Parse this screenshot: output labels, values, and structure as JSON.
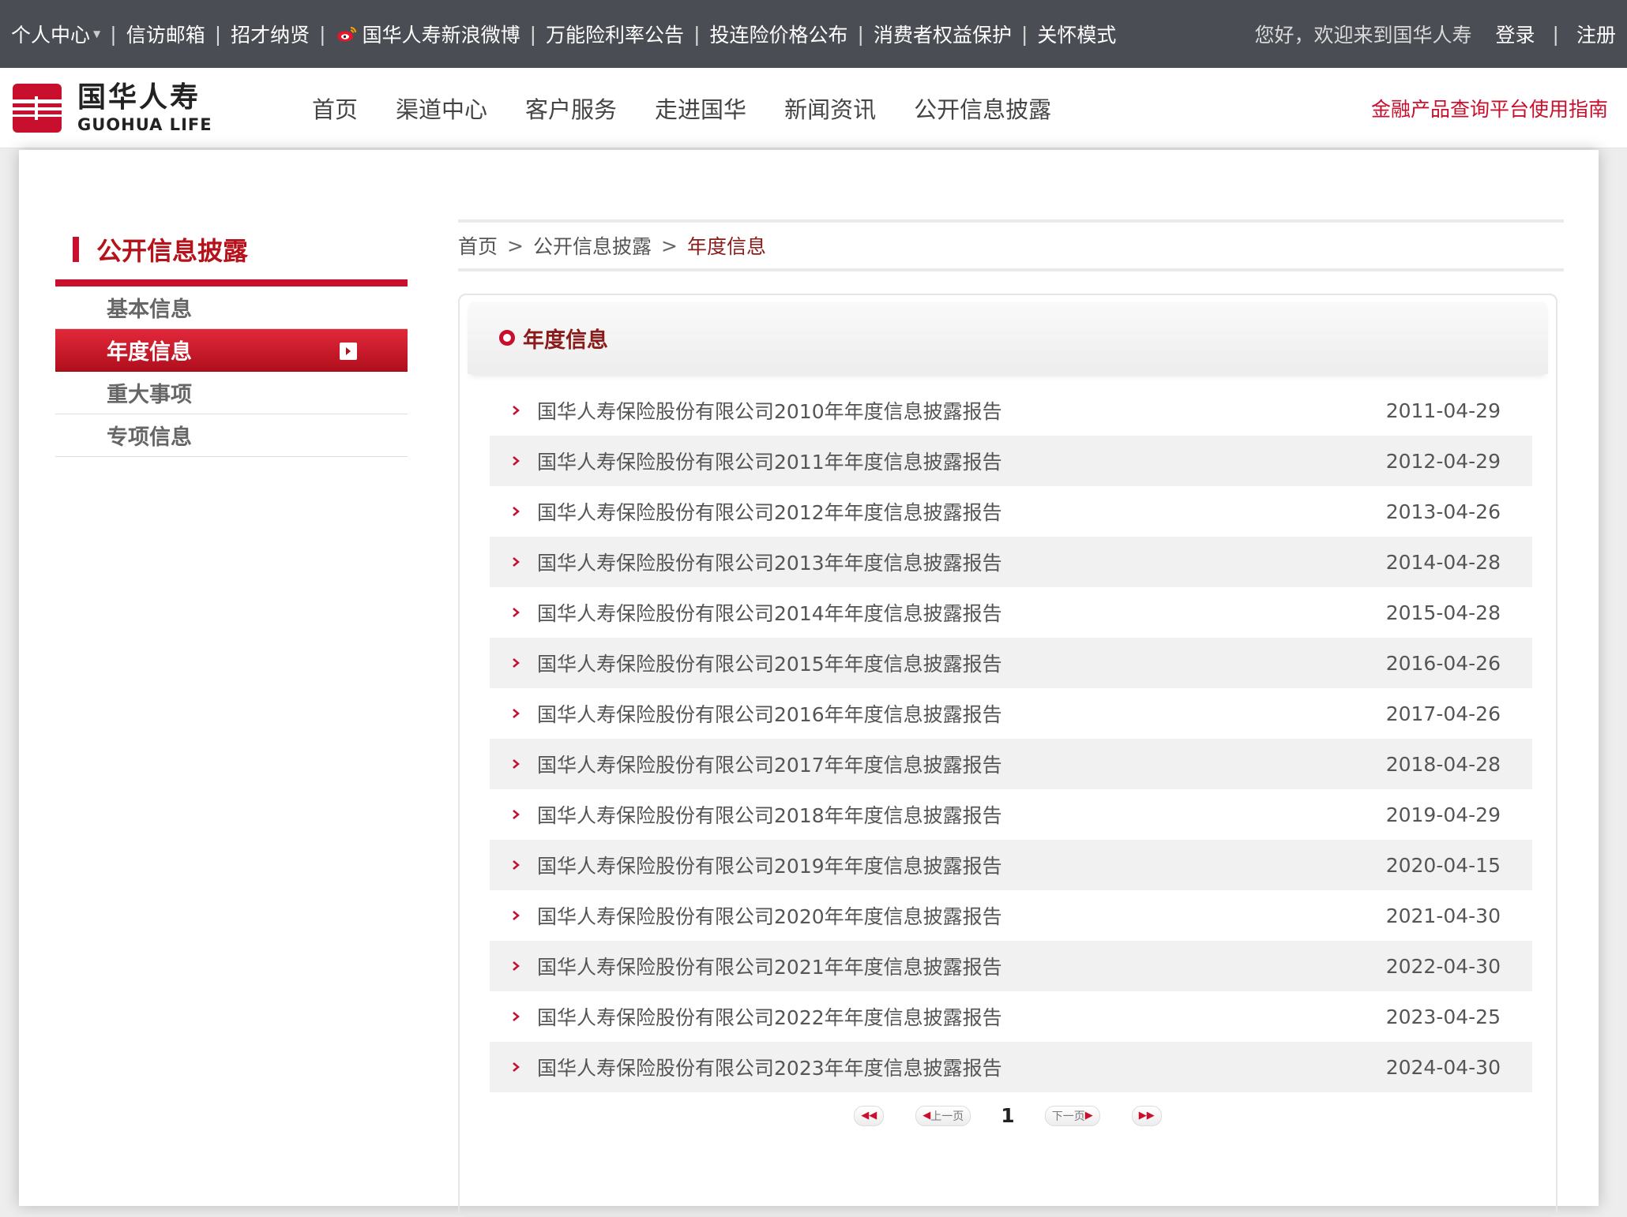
{
  "topbar": {
    "links": [
      "个人中心",
      "信访邮箱",
      "招才纳贤",
      "国华人寿新浪微博",
      "万能险利率公告",
      "投连险价格公布",
      "消费者权益保护",
      "关怀模式"
    ],
    "welcome": "您好，欢迎来到国华人寿",
    "login": "登录",
    "register": "注册",
    "separator": "|"
  },
  "header": {
    "logo_cn": "国华人寿",
    "logo_en": "GUOHUA LIFE",
    "nav": [
      "首页",
      "渠道中心",
      "客户服务",
      "走进国华",
      "新闻资讯",
      "公开信息披露"
    ],
    "guide": "金融产品查询平台使用指南"
  },
  "sidebar": {
    "title": "公开信息披露",
    "items": [
      "基本信息",
      "年度信息",
      "重大事项",
      "专项信息"
    ],
    "active_index": 1
  },
  "breadcrumb": {
    "home": "首页",
    "section": "公开信息披露",
    "current": "年度信息",
    "gt": ">"
  },
  "list": {
    "title": "年度信息",
    "rows": [
      {
        "name": "国华人寿保险股份有限公司2010年年度信息披露报告",
        "date": "2011-04-29"
      },
      {
        "name": "国华人寿保险股份有限公司2011年年度信息披露报告",
        "date": "2012-04-29"
      },
      {
        "name": "国华人寿保险股份有限公司2012年年度信息披露报告",
        "date": "2013-04-26"
      },
      {
        "name": "国华人寿保险股份有限公司2013年年度信息披露报告",
        "date": "2014-04-28"
      },
      {
        "name": "国华人寿保险股份有限公司2014年年度信息披露报告",
        "date": "2015-04-28"
      },
      {
        "name": "国华人寿保险股份有限公司2015年年度信息披露报告",
        "date": "2016-04-26"
      },
      {
        "name": "国华人寿保险股份有限公司2016年年度信息披露报告",
        "date": "2017-04-26"
      },
      {
        "name": "国华人寿保险股份有限公司2017年年度信息披露报告",
        "date": "2018-04-28"
      },
      {
        "name": "国华人寿保险股份有限公司2018年年度信息披露报告",
        "date": "2019-04-29"
      },
      {
        "name": "国华人寿保险股份有限公司2019年年度信息披露报告",
        "date": "2020-04-15"
      },
      {
        "name": "国华人寿保险股份有限公司2020年年度信息披露报告",
        "date": "2021-04-30"
      },
      {
        "name": "国华人寿保险股份有限公司2021年年度信息披露报告",
        "date": "2022-04-30"
      },
      {
        "name": "国华人寿保险股份有限公司2022年年度信息披露报告",
        "date": "2023-04-25"
      },
      {
        "name": "国华人寿保险股份有限公司2023年年度信息披露报告",
        "date": "2024-04-30"
      }
    ]
  },
  "pager": {
    "prev": "上一页",
    "next": "下一页",
    "current_page": "1"
  },
  "colors": {
    "brand_red": "#c8102e",
    "topbar_bg": "#4a4d53"
  }
}
